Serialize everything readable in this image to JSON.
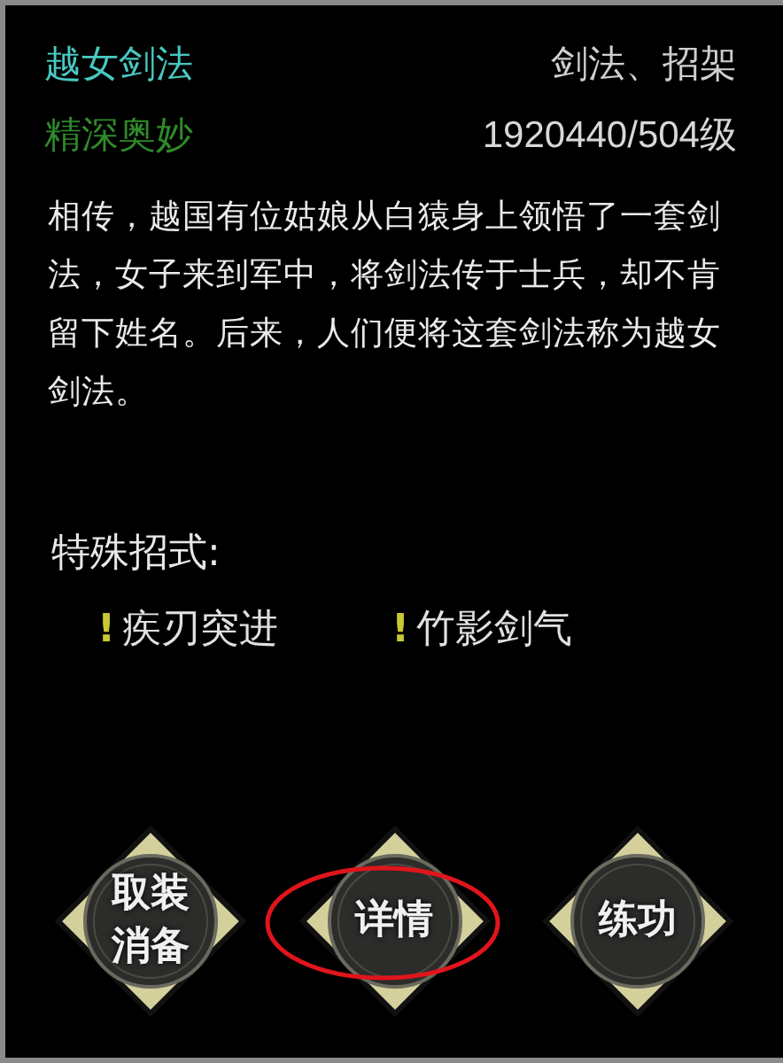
{
  "skill": {
    "name": "越女剑法",
    "category": "剑法、招架",
    "rank": "精深奥妙",
    "progress": "1920440/504级"
  },
  "description": "相传，越国有位姑娘从白猿身上领悟了一套剑法，女子来到军中，将剑法传于士兵，却不肯留下姓名。后来，人们便将这套剑法称为越女剑法。",
  "special_moves": {
    "heading": "特殊招式:",
    "items": [
      {
        "marker": "!",
        "name": "疾刃突进"
      },
      {
        "marker": "!",
        "name": "竹影剑气"
      }
    ]
  },
  "buttons": [
    {
      "lines": [
        "取装",
        "消备"
      ],
      "circled": false
    },
    {
      "lines": [
        "详情"
      ],
      "circled": true
    },
    {
      "lines": [
        "练功"
      ],
      "circled": false
    }
  ]
}
